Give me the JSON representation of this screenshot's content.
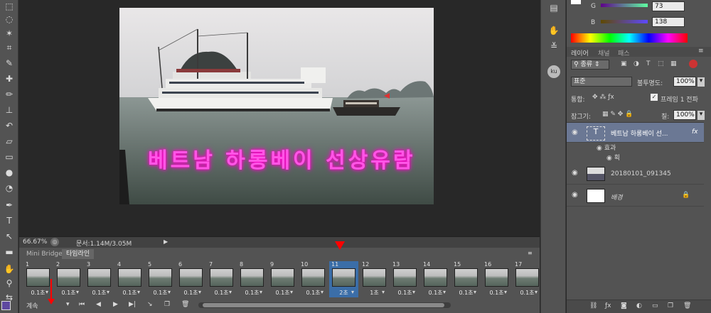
{
  "zoom": "66.67%",
  "doc_info": "문서:1.14M/3.05M",
  "photo_caption": "베트남 하롱베이 선상유람",
  "timeline": {
    "tabs": [
      "Mini Bridge",
      "타임라인"
    ],
    "frames": [
      {
        "num": "1",
        "dur": "0.1초"
      },
      {
        "num": "2",
        "dur": "0.1초"
      },
      {
        "num": "3",
        "dur": "0.1초"
      },
      {
        "num": "4",
        "dur": "0.1초"
      },
      {
        "num": "5",
        "dur": "0.1초"
      },
      {
        "num": "6",
        "dur": "0.1초"
      },
      {
        "num": "7",
        "dur": "0.1초"
      },
      {
        "num": "8",
        "dur": "0.1초"
      },
      {
        "num": "9",
        "dur": "0.1초"
      },
      {
        "num": "10",
        "dur": "0.1초"
      },
      {
        "num": "11",
        "dur": "2초"
      },
      {
        "num": "12",
        "dur": "1초"
      },
      {
        "num": "13",
        "dur": "0.1초"
      },
      {
        "num": "14",
        "dur": "0.1초"
      },
      {
        "num": "15",
        "dur": "0.1초"
      },
      {
        "num": "16",
        "dur": "0.1초"
      },
      {
        "num": "17",
        "dur": "0.1초"
      }
    ],
    "selected_frame": "11",
    "loop": "계속"
  },
  "color": {
    "g_label": "G",
    "g_value": "73",
    "b_label": "B",
    "b_value": "138"
  },
  "layers_panel": {
    "tabs": [
      "레이어",
      "채널",
      "패스"
    ],
    "filter": "종류",
    "blend_mode": "표준",
    "opacity_label": "불투명도:",
    "opacity": "100%",
    "unify_label": "통합:",
    "propagate_label": "프레임 1 전파",
    "lock_label": "잠그기:",
    "fill_label": "칠:",
    "fill": "100%",
    "layers": [
      {
        "name": "베트남 하롱베이 선...",
        "fx": "fx"
      },
      {
        "name": "20180101_091345"
      },
      {
        "name": "배경"
      }
    ],
    "effects_label": "효과",
    "stroke_label": "획"
  },
  "colors": {
    "accent": "#3b6ea8",
    "caption": "#ff33dd",
    "playhead": "#ff0000"
  }
}
